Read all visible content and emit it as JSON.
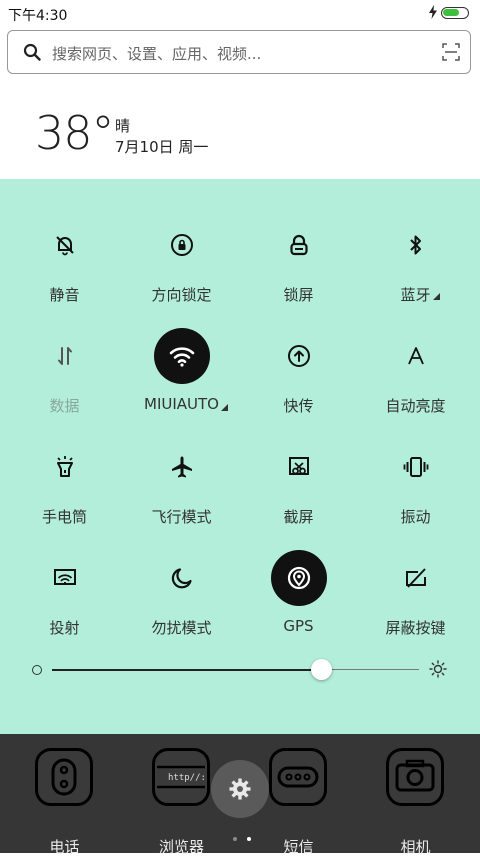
{
  "status_bar": {
    "time": "下午4:30",
    "battery_color": "#3fbf3f"
  },
  "search": {
    "placeholder": "搜索网页、设置、应用、视频..."
  },
  "weather": {
    "temperature": "38°",
    "condition": "晴",
    "date": "7月10日 周一"
  },
  "toggles": [
    {
      "label": "静音",
      "icon": "bell-off-icon",
      "active": false
    },
    {
      "label": "方向锁定",
      "icon": "rotation-lock-icon",
      "active": false
    },
    {
      "label": "锁屏",
      "icon": "lock-icon",
      "active": false
    },
    {
      "label": "蓝牙",
      "icon": "bluetooth-icon",
      "active": false,
      "expandable": true
    },
    {
      "label": "数据",
      "icon": "mobile-data-icon",
      "active": false,
      "disabled": true
    },
    {
      "label": "MIUIAUTO",
      "icon": "wifi-icon",
      "active": true,
      "expandable": true
    },
    {
      "label": "快传",
      "icon": "quick-transfer-icon",
      "active": false
    },
    {
      "label": "自动亮度",
      "icon": "auto-brightness-icon",
      "active": false
    },
    {
      "label": "手电筒",
      "icon": "flashlight-icon",
      "active": false
    },
    {
      "label": "飞行模式",
      "icon": "airplane-icon",
      "active": false
    },
    {
      "label": "截屏",
      "icon": "screenshot-icon",
      "active": false
    },
    {
      "label": "振动",
      "icon": "vibrate-icon",
      "active": false
    },
    {
      "label": "投射",
      "icon": "cast-icon",
      "active": false
    },
    {
      "label": "勿扰模式",
      "icon": "moon-icon",
      "active": false
    },
    {
      "label": "GPS",
      "icon": "gps-icon",
      "active": true
    },
    {
      "label": "屏蔽按键",
      "icon": "block-buttons-icon",
      "active": false
    }
  ],
  "brightness": {
    "level": 0.73
  },
  "dock": {
    "apps": [
      {
        "label": "电话",
        "icon": "phone-app-icon"
      },
      {
        "label": "浏览器",
        "icon": "browser-app-icon",
        "icon_text": "http//:"
      },
      {
        "label": "短信",
        "icon": "messages-app-icon"
      },
      {
        "label": "相机",
        "icon": "camera-app-icon"
      }
    ],
    "settings_icon": "gear-icon",
    "page_count": 2,
    "current_page": 2
  },
  "colors": {
    "panel_bg": "#b3eedb",
    "active_toggle_bg": "#111111",
    "dock_bg": "#363636"
  }
}
